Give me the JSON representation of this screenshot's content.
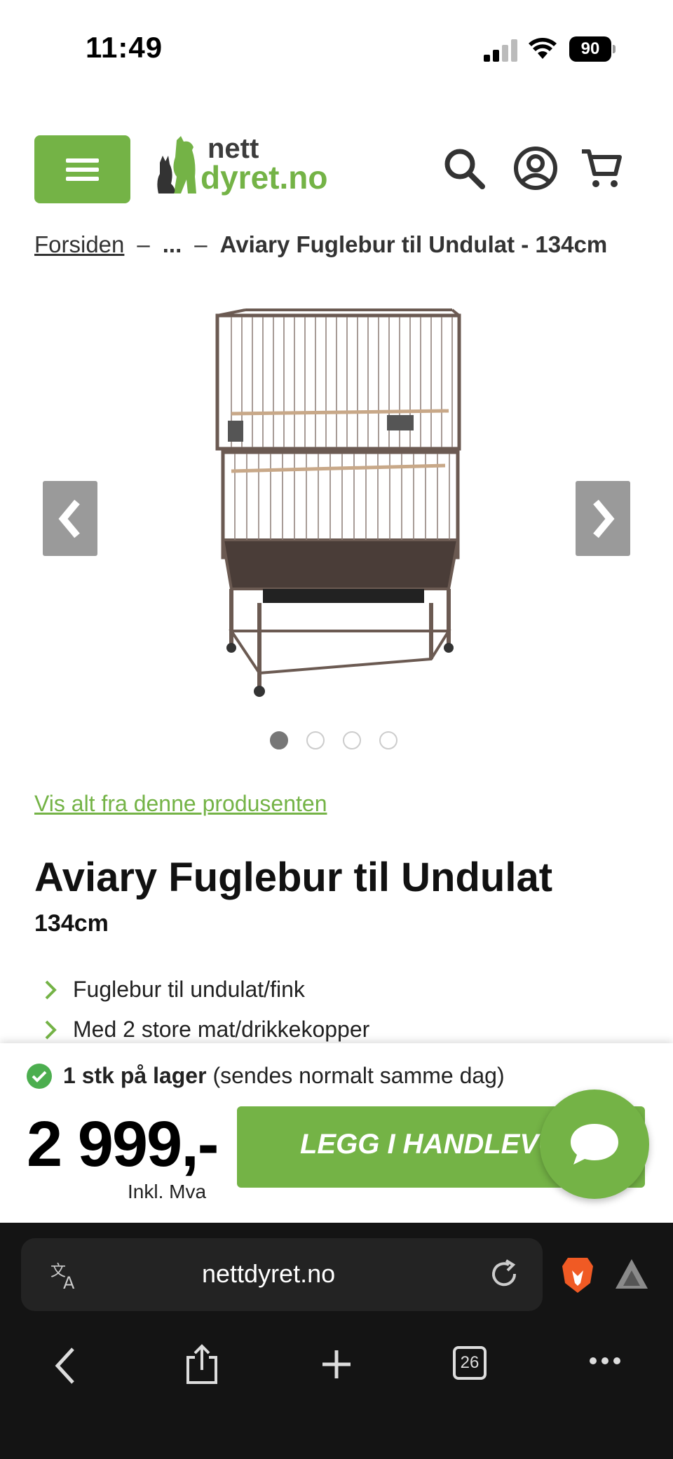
{
  "status_bar": {
    "time": "11:49",
    "battery": "90",
    "icons": [
      "signal-icon",
      "wifi-icon",
      "battery-icon"
    ]
  },
  "header": {
    "logo": {
      "line1": "nett",
      "line2": "dyret.no"
    },
    "icons": [
      "menu-icon",
      "search-icon",
      "account-icon",
      "cart-icon"
    ]
  },
  "breadcrumb": {
    "home": "Forsiden",
    "sep": "–",
    "ellipsis": "...",
    "current": "Aviary Fuglebur til Undulat - 134cm"
  },
  "gallery": {
    "slide_count": 4,
    "active_index": 0
  },
  "brand_link": "Vis alt fra denne produsenten",
  "product": {
    "title": "Aviary Fuglebur til Undulat",
    "subtitle": "134cm",
    "features": [
      "Fuglebur til undulat/fink",
      "Med 2 store mat/drikkekopper"
    ]
  },
  "purchase": {
    "stock_strong": "1 stk på lager",
    "stock_note": "(sendes normalt samme dag)",
    "price": "2 999,-",
    "vat": "Inkl. Mva",
    "add_to_cart": "LEGG I HANDLEVOGN"
  },
  "colors": {
    "brand_green": "#74b346",
    "stock_green": "#4cae4f",
    "browser_bg": "#141414"
  },
  "browser": {
    "url": "nettdyret.no",
    "tab_count": "26",
    "icons": [
      "translate-icon",
      "reload-icon",
      "brave-lion-icon",
      "rewards-triangle-icon",
      "back-icon",
      "share-icon",
      "new-tab-icon",
      "tabs-icon",
      "more-icon"
    ]
  }
}
